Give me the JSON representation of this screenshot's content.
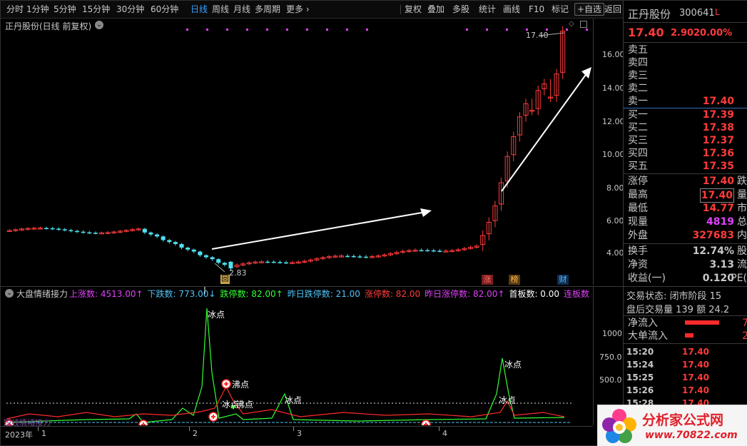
{
  "toolbar": {
    "periods": [
      "分时",
      "1分钟",
      "5分钟",
      "15分钟",
      "30分钟",
      "60分钟",
      "日线",
      "周线",
      "月线",
      "多周期",
      "更多 ›"
    ],
    "active_period": "日线",
    "tools": [
      "复权",
      "叠加",
      "多股",
      "统计",
      "画线",
      "F10",
      "标记",
      "+自选",
      "返回"
    ]
  },
  "chart": {
    "title": "正丹股份(日线 前复权)",
    "price_axis": [
      "16.00",
      "14.00",
      "12.00",
      "10.00",
      "8.00",
      "6.00",
      "4.00"
    ],
    "high_label": "17.40",
    "low_label": "2.83",
    "event_tags": [
      "涨",
      "榜",
      "财"
    ],
    "return_icon": "回"
  },
  "indicator": {
    "name": "大盘情绪接力",
    "items": [
      {
        "label": "上涨数: 4513.00↑",
        "color": "#e040fb"
      },
      {
        "label": "下跌数: 773.00↓",
        "color": "#4fc3f7"
      },
      {
        "label": "跌停数: 82.00↑",
        "color": "#33ff33"
      },
      {
        "label": "昨日跌停数: 21.00",
        "color": "#4fc3f7"
      },
      {
        "label": "涨停数: 82.00",
        "color": "#ff3b3b"
      },
      {
        "label": "昨日涨停数: 82.00↑",
        "color": "#e040fb"
      },
      {
        "label": "首板数: 0.00",
        "color": "#ffffff"
      },
      {
        "label": "连板数: 0.00",
        "color": "#e040fb"
      }
    ],
    "axis": [
      "1000",
      "750.0",
      "500.0"
    ],
    "annotations": [
      "冰点",
      "沸点",
      "冰点",
      "沸点",
      "冰点",
      "冰点",
      "冰点"
    ],
    "watermark": "短线情绪接力"
  },
  "date_axis": [
    "2023年",
    "1",
    "2",
    "3",
    "4"
  ],
  "panel": {
    "stock_name": "正丹股份",
    "stock_code": "300641",
    "flag": "L",
    "price": "17.40",
    "change": "2.90",
    "change_pct": "20.00%",
    "asks": [
      {
        "label": "卖五",
        "price": ""
      },
      {
        "label": "卖四",
        "price": ""
      },
      {
        "label": "卖三",
        "price": ""
      },
      {
        "label": "卖二",
        "price": ""
      },
      {
        "label": "卖一",
        "price": "17.40"
      }
    ],
    "bids": [
      {
        "label": "买一",
        "price": "17.39"
      },
      {
        "label": "买二",
        "price": "17.38"
      },
      {
        "label": "买三",
        "price": "17.37"
      },
      {
        "label": "买四",
        "price": "17.36"
      },
      {
        "label": "买五",
        "price": "17.35"
      }
    ],
    "stats": [
      {
        "label": "涨停",
        "value": "17.40",
        "right": "跌停"
      },
      {
        "label": "最高",
        "value": "17.40",
        "right": "量比"
      },
      {
        "label": "最低",
        "value": "14.77",
        "right": "市值"
      },
      {
        "label": "现量",
        "value": "4819",
        "right": "总量"
      },
      {
        "label": "外盘",
        "value": "327683",
        "right": "内盘"
      }
    ],
    "fin": [
      {
        "label": "换手",
        "value": "12.74%",
        "right": "股本"
      },
      {
        "label": "净资",
        "value": "3.13",
        "right": "流通"
      },
      {
        "label": "收益(一)",
        "value": "0.120",
        "right": "PE(动"
      }
    ],
    "trade_status": "交易状态: 闭市阶段 15",
    "after_hours": "盘后交易量 139 额 24.2",
    "flows": [
      {
        "label": "净流入",
        "value": "7"
      },
      {
        "label": "大单流入",
        "value": "2"
      }
    ],
    "ticks": [
      {
        "time": "15:20",
        "price": "17.40"
      },
      {
        "time": "15:24",
        "price": "17.40"
      },
      {
        "time": "15:25",
        "price": "17.40"
      },
      {
        "time": "15:26",
        "price": "17.40"
      },
      {
        "time": "15:28",
        "price": "17.40"
      }
    ]
  },
  "logo": {
    "title": "分析家公式网",
    "url": "www.70822.com"
  }
}
